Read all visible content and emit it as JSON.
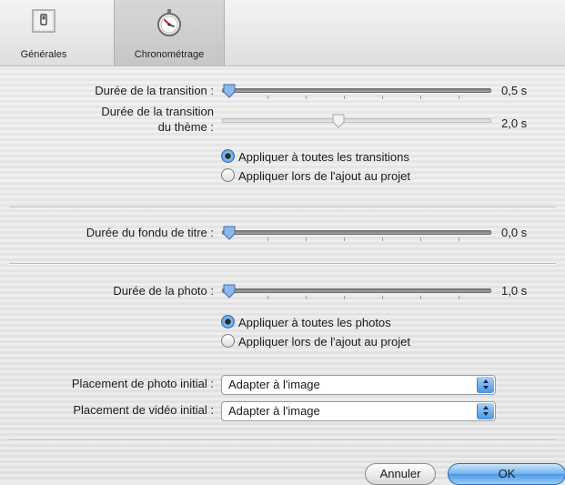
{
  "tabs": [
    {
      "label": "Générales",
      "icon": "switch-icon"
    },
    {
      "label": "Chronométrage",
      "icon": "stopwatch-icon",
      "selected": true
    }
  ],
  "transition": {
    "duration_label": "Durée de la transition :",
    "duration_value": "0,5 s",
    "theme_label_line1": "Durée de la transition",
    "theme_label_line2": "du thème :",
    "theme_value": "2,0 s",
    "option_all": "Appliquer à toutes les transitions",
    "option_add": "Appliquer lors de l'ajout au projet",
    "selected_option": "all"
  },
  "title_fade": {
    "label": "Durée du fondu de titre :",
    "value": "0,0 s"
  },
  "photo": {
    "label": "Durée de la photo :",
    "value": "1,0 s",
    "option_all": "Appliquer à toutes les photos",
    "option_add": "Appliquer lors de l'ajout au projet",
    "selected_option": "all"
  },
  "placement": {
    "photo_label": "Placement de photo initial :",
    "photo_value": "Adapter à l'image",
    "video_label": "Placement de vidéo initial :",
    "video_value": "Adapter à l'image"
  },
  "buttons": {
    "cancel": "Annuler",
    "ok": "OK"
  },
  "colors": {
    "accent": "#4b98e5",
    "knob": "#8fb8e8"
  }
}
